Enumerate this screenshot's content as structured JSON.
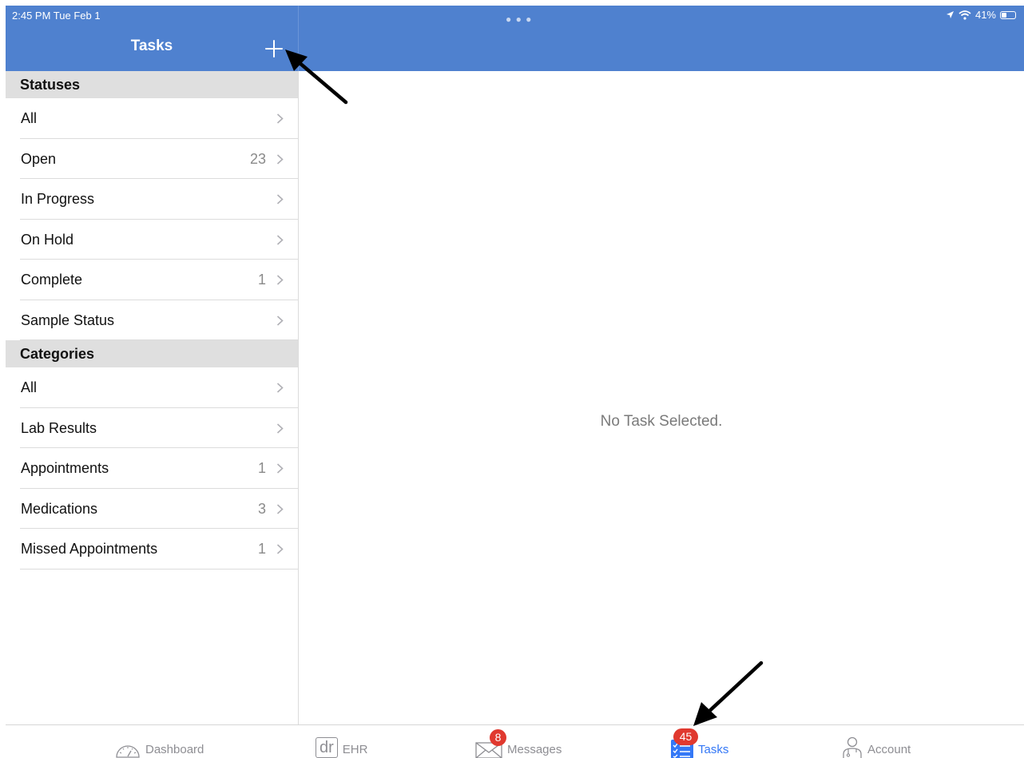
{
  "status_bar": {
    "time": "2:45 PM  Tue Feb 1",
    "battery": "41%",
    "battery_level": 0.41
  },
  "nav": {
    "title": "Tasks",
    "add_icon": "plus-icon"
  },
  "sidebar": {
    "statuses_header": "Statuses",
    "statuses": [
      {
        "label": "All",
        "count": ""
      },
      {
        "label": "Open",
        "count": "23"
      },
      {
        "label": "In Progress",
        "count": ""
      },
      {
        "label": "On Hold",
        "count": ""
      },
      {
        "label": "Complete",
        "count": "1"
      },
      {
        "label": "Sample Status",
        "count": ""
      }
    ],
    "categories_header": "Categories",
    "categories": [
      {
        "label": "All",
        "count": ""
      },
      {
        "label": "Lab Results",
        "count": ""
      },
      {
        "label": "Appointments",
        "count": "1"
      },
      {
        "label": "Medications",
        "count": "3"
      },
      {
        "label": "Missed Appointments",
        "count": "1"
      }
    ]
  },
  "detail": {
    "empty_message": "No Task Selected."
  },
  "tabbar": {
    "dashboard": {
      "label": "Dashboard",
      "icon": "speedometer-icon"
    },
    "ehr": {
      "label": "EHR",
      "icon_text": "dr"
    },
    "messages": {
      "label": "Messages",
      "badge": "8",
      "icon": "envelope-icon"
    },
    "tasks": {
      "label": "Tasks",
      "badge": "45",
      "icon": "checklist-icon"
    },
    "account": {
      "label": "Account",
      "icon": "doctor-icon"
    }
  },
  "colors": {
    "nav_blue": "#4f81cf",
    "active_tab": "#3478f6",
    "badge_red": "#e0392f",
    "section_gray": "#dfdfdf"
  }
}
